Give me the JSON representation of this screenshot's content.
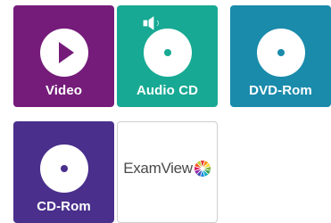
{
  "tiles": [
    {
      "id": "video",
      "label": "Video",
      "color": "#751c7a",
      "icon": "play-icon"
    },
    {
      "id": "audio",
      "label": "Audio CD",
      "color": "#17a993",
      "icon": "audio-cd-icon"
    },
    {
      "id": "dvd",
      "label": "DVD-Rom",
      "color": "#1a8bab",
      "icon": "disc-icon"
    },
    {
      "id": "cdrom",
      "label": "CD-Rom",
      "color": "#4a2f8c",
      "icon": "disc-icon"
    }
  ],
  "examview": {
    "logo_text": "ExamView",
    "icon": "examview-logo"
  }
}
